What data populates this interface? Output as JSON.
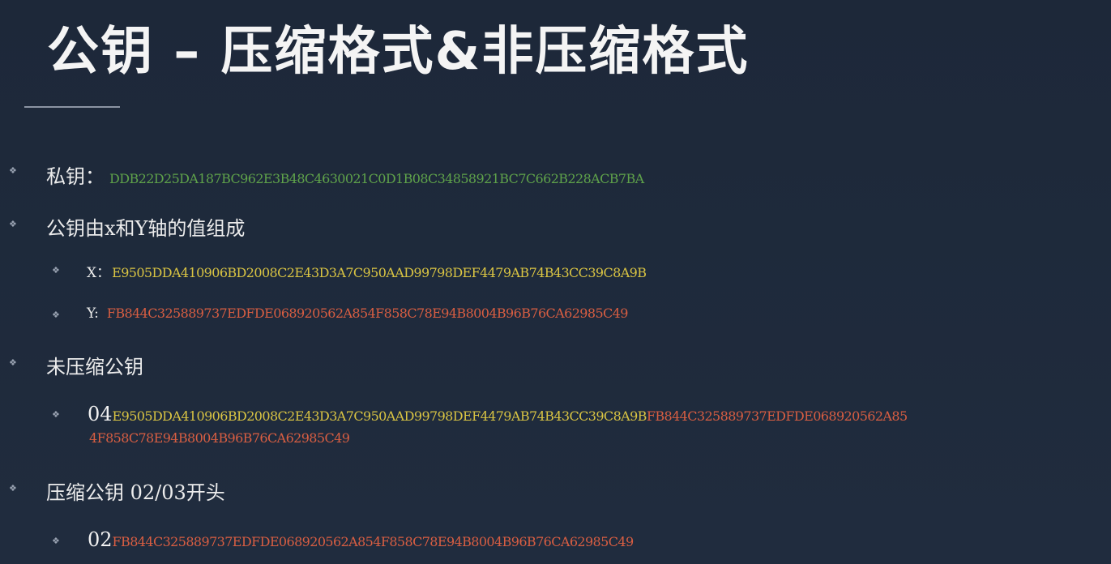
{
  "title": "公钥 – 压缩格式&非压缩格式",
  "bullet_glyph": "❖",
  "colors": {
    "background": "#1f2a3b",
    "private_key": "#5fa24a",
    "x_coordinate": "#d9c443",
    "y_coordinate": "#d95e42"
  },
  "private_key": {
    "label": "私钥：",
    "value": "DDB22D25DA187BC962E3B48C4630021C0D1B08C34858921BC7C662B228ACB7BA"
  },
  "public_key_composition": {
    "label": "公钥由x和Y轴的值组成",
    "x_label": "X：",
    "x_value": "E9505DDA410906BD2008C2E43D3A7C950AAD99798DEF4479AB74B43CC39C8A9B",
    "y_label": "Y: ",
    "y_value": "FB844C325889737EDFDE068920562A854F858C78E94B8004B96B76CA62985C49"
  },
  "uncompressed": {
    "label": "未压缩公钥",
    "prefix": "04",
    "x_value": "E9505DDA410906BD2008C2E43D3A7C950AAD99798DEF4479AB74B43CC39C8A9B",
    "y_value_line1": "FB844C325889737EDFDE068920562A85",
    "y_value_line2": "4F858C78E94B8004B96B76CA62985C49"
  },
  "compressed": {
    "label": "压缩公钥 02/03开头",
    "prefix": "02",
    "value": "FB844C325889737EDFDE068920562A854F858C78E94B8004B96B76CA62985C49"
  }
}
